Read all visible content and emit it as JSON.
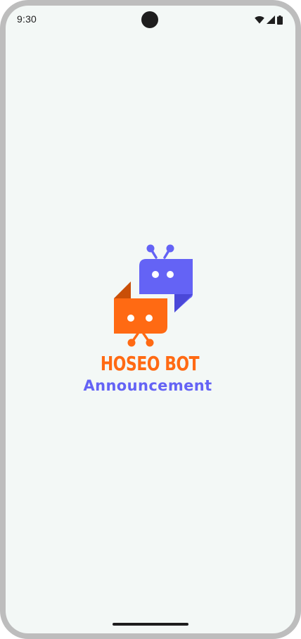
{
  "status_bar": {
    "time": "9:30",
    "icons": [
      "wifi-icon",
      "cellular-signal-icon",
      "battery-icon"
    ]
  },
  "logo": {
    "title": "HOSEO BOT",
    "subtitle": "Announcement",
    "icon": "chat-robots-logo-icon"
  },
  "colors": {
    "background": "#f3f8f6",
    "title_orange": "#ff6a13",
    "subtitle_purple": "#6463f5",
    "bot_purple": "#6463f5",
    "bot_orange": "#ff6a13",
    "device_frame": "#bdbdbd"
  }
}
